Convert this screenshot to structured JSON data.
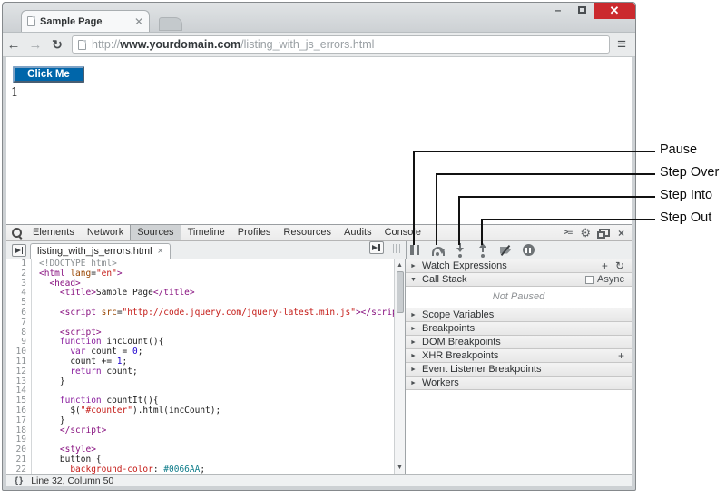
{
  "window": {
    "tab_title": "Sample Page",
    "control_icons": [
      "minimize",
      "maximize",
      "close"
    ]
  },
  "browser": {
    "url": {
      "prefix": "http://",
      "domain": "www.yourdomain.com",
      "path": "/listing_with_js_errors.html"
    }
  },
  "page": {
    "button_label": "Click Me",
    "button_color": "#0066AA",
    "counter_value": "1"
  },
  "annotations": {
    "labels": [
      "Pause",
      "Step Over",
      "Step Into",
      "Step Out"
    ]
  },
  "devtools": {
    "panel_tabs": [
      {
        "label": "Elements"
      },
      {
        "label": "Network"
      },
      {
        "label": "Sources",
        "active": true
      },
      {
        "label": "Timeline"
      },
      {
        "label": "Profiles"
      },
      {
        "label": "Resources"
      },
      {
        "label": "Audits"
      },
      {
        "label": "Console"
      }
    ],
    "file_tab": {
      "label": "listing_with_js_errors.html",
      "close": "×"
    },
    "debugger_buttons": [
      {
        "name": "pause"
      },
      {
        "name": "step-over"
      },
      {
        "name": "step-into"
      },
      {
        "name": "step-out"
      },
      {
        "name": "deactivate-breakpoints"
      },
      {
        "name": "pause-on-exceptions"
      }
    ],
    "sidebar": {
      "sections": [
        {
          "label": "Watch Expressions",
          "state": "collapsed",
          "actions": [
            "plus",
            "refresh"
          ]
        },
        {
          "label": "Call Stack",
          "state": "expanded",
          "async_checkbox": true,
          "content": "Not Paused"
        },
        {
          "label": "Scope Variables",
          "state": "collapsed"
        },
        {
          "label": "Breakpoints",
          "state": "collapsed"
        },
        {
          "label": "DOM Breakpoints",
          "state": "collapsed"
        },
        {
          "label": "XHR Breakpoints",
          "state": "collapsed",
          "actions": [
            "plus"
          ]
        },
        {
          "label": "Event Listener Breakpoints",
          "state": "collapsed"
        },
        {
          "label": "Workers",
          "state": "collapsed"
        }
      ],
      "async_label": "Async"
    },
    "status_text": "Line 32, Column 50",
    "code": {
      "lines": [
        {
          "n": 1,
          "t": [
            [
              "g",
              "<!DOCTYPE html>"
            ]
          ]
        },
        {
          "n": 2,
          "t": [
            [
              "t",
              "<html "
            ],
            [
              "a",
              "lang"
            ],
            [
              "p",
              "="
            ],
            [
              "s",
              "\"en\""
            ],
            [
              "t",
              ">"
            ]
          ]
        },
        {
          "n": 3,
          "t": [
            [
              "t",
              "  <head>"
            ]
          ]
        },
        {
          "n": 4,
          "t": [
            [
              "t",
              "    <title>"
            ],
            [
              "p",
              "Sample Page"
            ],
            [
              "t",
              "</title>"
            ]
          ]
        },
        {
          "n": 5,
          "t": []
        },
        {
          "n": 6,
          "t": [
            [
              "t",
              "    <script "
            ],
            [
              "a",
              "src"
            ],
            [
              "p",
              "="
            ],
            [
              "s",
              "\"http://code.jquery.com/jquery-latest.min.js\""
            ],
            [
              "t",
              "></script>"
            ]
          ]
        },
        {
          "n": 7,
          "t": []
        },
        {
          "n": 8,
          "t": [
            [
              "t",
              "    <script>"
            ]
          ]
        },
        {
          "n": 9,
          "t": [
            [
              "p",
              "    "
            ],
            [
              "k",
              "function"
            ],
            [
              "p",
              " incCount(){"
            ]
          ]
        },
        {
          "n": 10,
          "t": [
            [
              "p",
              "      "
            ],
            [
              "k",
              "var"
            ],
            [
              "p",
              " count = "
            ],
            [
              "n",
              "0"
            ],
            [
              "p",
              ";"
            ]
          ]
        },
        {
          "n": 11,
          "t": [
            [
              "p",
              "      count += "
            ],
            [
              "n",
              "1"
            ],
            [
              "p",
              ";"
            ]
          ]
        },
        {
          "n": 12,
          "t": [
            [
              "p",
              "      "
            ],
            [
              "k",
              "return"
            ],
            [
              "p",
              " count;"
            ]
          ]
        },
        {
          "n": 13,
          "t": [
            [
              "p",
              "    }"
            ]
          ]
        },
        {
          "n": 14,
          "t": []
        },
        {
          "n": 15,
          "t": [
            [
              "p",
              "    "
            ],
            [
              "k",
              "function"
            ],
            [
              "p",
              " countIt(){"
            ]
          ]
        },
        {
          "n": 16,
          "t": [
            [
              "p",
              "      $("
            ],
            [
              "s",
              "\"#counter\""
            ],
            [
              "p",
              ").html(incCount);"
            ]
          ]
        },
        {
          "n": 17,
          "t": [
            [
              "p",
              "    }"
            ]
          ]
        },
        {
          "n": 18,
          "t": [
            [
              "t",
              "    </script>"
            ]
          ]
        },
        {
          "n": 19,
          "t": []
        },
        {
          "n": 20,
          "t": [
            [
              "t",
              "    <style>"
            ]
          ]
        },
        {
          "n": 21,
          "t": [
            [
              "p",
              "    button {"
            ]
          ]
        },
        {
          "n": 22,
          "t": [
            [
              "pr",
              "      background-color"
            ],
            [
              "p",
              ": "
            ],
            [
              "v",
              "#0066AA"
            ],
            [
              "p",
              ";"
            ]
          ]
        }
      ]
    }
  }
}
